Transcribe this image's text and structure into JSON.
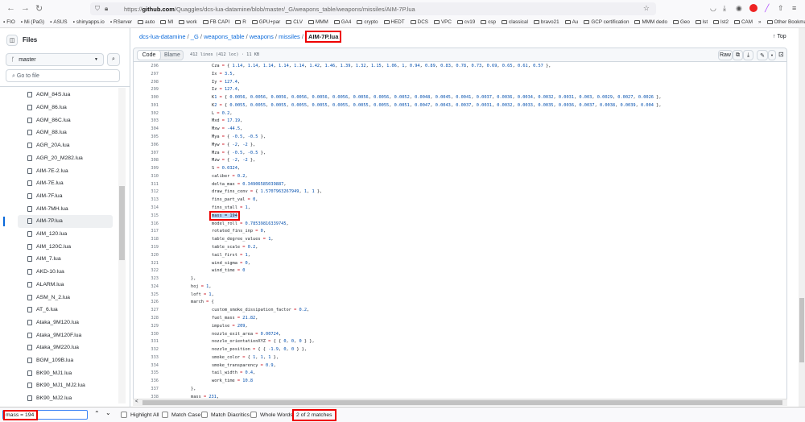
{
  "browser": {
    "url_prefix": "https://",
    "url_domain": "github.com",
    "url_path": "/Quaggles/dcs-lua-datamine/blob/master/_G/weapons_table/weapons/missiles/AIM-7P.lua",
    "bookmarks": [
      "FIO",
      "Mi (PaG)",
      "ASUS",
      "shinyapps.io",
      "RServer",
      "auto",
      "MI",
      "work",
      "FB CAPI",
      "R",
      "GPU+par",
      "CLV",
      "MMM",
      "GA4",
      "crypto",
      "HEDT",
      "DCS",
      "VPC",
      "cv19",
      "csp",
      "classical",
      "bravo21",
      "Au",
      "GCP certification",
      "MMM dedo",
      "Geo",
      "lst",
      "lst2",
      "CAM"
    ],
    "other_bookmarks": "Other Bookmarks",
    "overflow": "»"
  },
  "sidebar": {
    "title": "Files",
    "branch": "master",
    "goto_placeholder": "Go to file",
    "files": [
      "AGM_84S.lua",
      "AGM_86.lua",
      "AGM_86C.lua",
      "AGM_88.lua",
      "AGR_20A.lua",
      "AGR_20_M282.lua",
      "AIM-7E-2.lua",
      "AIM-7E.lua",
      "AIM-7F.lua",
      "AIM-7MH.lua",
      "AIM-7P.lua",
      "AIM_120.lua",
      "AIM_120C.lua",
      "AIM_7.lua",
      "AKD-10.lua",
      "ALARM.lua",
      "ASM_N_2.lua",
      "AT_6.lua",
      "Ataka_9M120.lua",
      "Ataka_9M120F.lua",
      "Ataka_9M220.lua",
      "BGM_109B.lua",
      "BK90_MJ1.lua",
      "BK90_MJ1_MJ2.lua",
      "BK90_MJ2.lua"
    ],
    "active_index": 10
  },
  "breadcrumb": {
    "parts": [
      "dcs-lua-datamine",
      "_G",
      "weapons_table",
      "weapons",
      "missiles"
    ],
    "current": "AIM-7P.lua",
    "top": "Top"
  },
  "codeheader": {
    "code": "Code",
    "blame": "Blame",
    "info": "412 lines (412 loc) · 11 KB",
    "raw": "Raw"
  },
  "code": [
    [
      296,
      2,
      "Cza = { 1.14, 1.14, 1.14, 1.14, 1.14, 1.42, 1.46, 1.39, 1.32, 1.15, 1.06, 1, 0.94, 0.89, 0.83, 0.78, 0.73, 0.69, 0.65, 0.61, 0.57 },"
    ],
    [
      297,
      2,
      "Ix = 3.5,"
    ],
    [
      298,
      2,
      "Iy = 127.4,"
    ],
    [
      299,
      2,
      "Iz = 127.4,"
    ],
    [
      300,
      2,
      "K1 = { 0.0056, 0.0056, 0.0056, 0.0056, 0.0056, 0.0056, 0.0056, 0.0056, 0.0052, 0.0048, 0.0045, 0.0041, 0.0037, 0.0036, 0.0034, 0.0032, 0.0031, 0.003, 0.0029, 0.0027, 0.0026 },"
    ],
    [
      301,
      2,
      "K2 = { 0.0055, 0.0055, 0.0055, 0.0055, 0.0055, 0.0055, 0.0055, 0.0055, 0.0051, 0.0047, 0.0043, 0.0037, 0.0031, 0.0032, 0.0033, 0.0035, 0.0036, 0.0037, 0.0038, 0.0039, 0.004 },"
    ],
    [
      302,
      2,
      "L = 0.2,"
    ],
    [
      303,
      2,
      "Mxd = 17.19,"
    ],
    [
      304,
      2,
      "Mxw = -44.5,"
    ],
    [
      305,
      2,
      "Mya = { -0.5, -0.5 },"
    ],
    [
      306,
      2,
      "Myw = { -2, -2 },"
    ],
    [
      307,
      2,
      "Mza = { -0.5, -0.5 },"
    ],
    [
      308,
      2,
      "Mzw = { -2, -2 },"
    ],
    [
      309,
      2,
      "S = 0.0324,"
    ],
    [
      310,
      2,
      "caliber = 0.2,"
    ],
    [
      311,
      2,
      "delta_max = 0.34906585039887,"
    ],
    [
      312,
      2,
      "draw_fins_conv = { 1.5707963267949, 1, 1 },"
    ],
    [
      313,
      2,
      "fins_part_val = 0,"
    ],
    [
      314,
      2,
      "fins_stall = 1,"
    ],
    [
      315,
      2,
      "mass = 194,"
    ],
    [
      316,
      2,
      "model_roll = 0.78539816339745,"
    ],
    [
      317,
      2,
      "rotated_fins_inp = 0,"
    ],
    [
      318,
      2,
      "table_degree_values = 1,"
    ],
    [
      319,
      2,
      "table_scale = 0.2,"
    ],
    [
      320,
      2,
      "tail_first = 1,"
    ],
    [
      321,
      2,
      "wind_sigma = 0,"
    ],
    [
      322,
      2,
      "wind_time = 0"
    ],
    [
      323,
      1,
      "},"
    ],
    [
      324,
      1,
      "hoj = 1,"
    ],
    [
      325,
      1,
      "loft = 1,"
    ],
    [
      326,
      1,
      "march = {"
    ],
    [
      327,
      2,
      "custom_smoke_dissipation_factor = 0.2,"
    ],
    [
      328,
      2,
      "fuel_mass = 21.82,"
    ],
    [
      329,
      2,
      "impulse = 209,"
    ],
    [
      330,
      2,
      "nozzle_exit_area = 0.00724,"
    ],
    [
      331,
      2,
      "nozzle_orientationXYZ = { { 0, 0, 0 } },"
    ],
    [
      332,
      2,
      "nozzle_position = { { -1.9, 0, 0 } },"
    ],
    [
      333,
      2,
      "smoke_color = { 1, 1, 1 },"
    ],
    [
      334,
      2,
      "smoke_transparency = 0.9,"
    ],
    [
      335,
      2,
      "tail_width = 0.4,"
    ],
    [
      336,
      2,
      "work_time = 10.8"
    ],
    [
      337,
      1,
      "},"
    ],
    [
      338,
      1,
      "mass = 231,"
    ]
  ],
  "highlight_line": 315,
  "findbar": {
    "query": "mass = 194",
    "highlight_all": "Highlight All",
    "match_case": "Match Case",
    "match_diacritics": "Match Diacritics",
    "whole_words": "Whole Words",
    "status": "2 of 2 matches"
  }
}
